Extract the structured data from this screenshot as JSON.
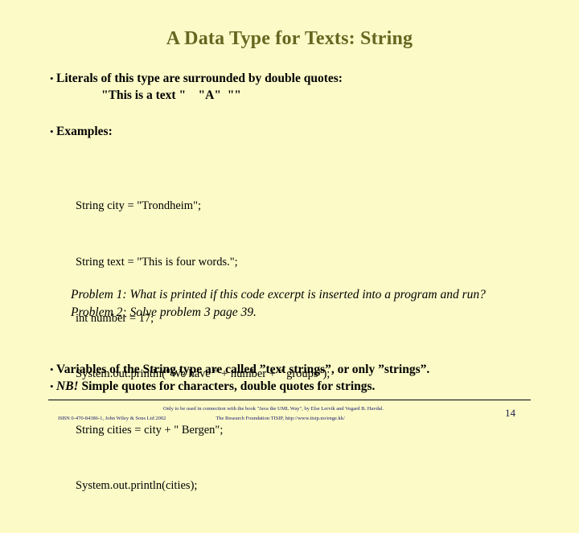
{
  "slide": {
    "title": "A Data Type for Texts: String",
    "page_number": "14",
    "background_color": "#fcfbc8",
    "title_color": "#666620",
    "footer_color": "#17176b"
  },
  "bullets": [
    {
      "marker": "•",
      "text": "Literals of this type are surrounded by double quotes:",
      "continuation": "\"This is a text \"    \"A\"  \"\""
    },
    {
      "marker": "•",
      "text": "Examples:"
    }
  ],
  "code": {
    "lines": [
      "String city = \"Trondheim\";",
      "String text = \"This is four words.\";",
      "int number = 17;",
      "System.out.println(\"We have \" + number + \" groups\");",
      "String cities = city + \" Bergen\";",
      "System.out.println(cities);"
    ]
  },
  "problems": {
    "lines": [
      "Problem 1: What is printed if this code excerpt is inserted into a program and run?",
      "Problem 2: Solve problem 3 page 39."
    ]
  },
  "closing_bullets": [
    {
      "marker": "•",
      "text": "Variables of the String type are called ”text strings”, or only ”strings”."
    },
    {
      "marker": "•",
      "emphasis": "NB!",
      "text": " Simple quotes for characters, double quotes for strings."
    }
  ],
  "footer": {
    "line1": "Only to be used in connection with the book \"Java the UML Way\", by Else Lervik and Vegard B. Havdal.",
    "line2a": "ISBN 0-470-84386-1, John Wiley & Sons Ltd 2002",
    "line2b": "The Research Foundation TISIP, http://www.tisip.no/enge.kk/"
  }
}
